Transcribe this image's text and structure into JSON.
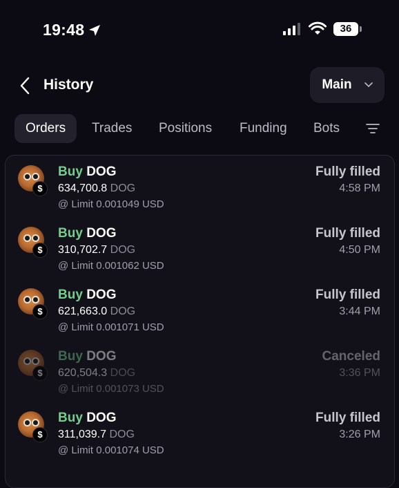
{
  "status_bar": {
    "time": "19:48",
    "battery": "36"
  },
  "header": {
    "title": "History",
    "account": "Main"
  },
  "tabs": [
    {
      "label": "Orders",
      "active": true
    },
    {
      "label": "Trades",
      "active": false
    },
    {
      "label": "Positions",
      "active": false
    },
    {
      "label": "Funding",
      "active": false
    },
    {
      "label": "Bots",
      "active": false
    }
  ],
  "orders": [
    {
      "side": "Buy",
      "asset": "DOG",
      "amount": "634,700.8",
      "unit": "DOG",
      "price_line": "@ Limit 0.001049 USD",
      "status": "Fully filled",
      "time": "4:58 PM",
      "coin_symbol": "$"
    },
    {
      "side": "Buy",
      "asset": "DOG",
      "amount": "310,702.7",
      "unit": "DOG",
      "price_line": "@ Limit 0.001062 USD",
      "status": "Fully filled",
      "time": "4:50 PM",
      "coin_symbol": "$"
    },
    {
      "side": "Buy",
      "asset": "DOG",
      "amount": "621,663.0",
      "unit": "DOG",
      "price_line": "@ Limit 0.001071 USD",
      "status": "Fully filled",
      "time": "3:44 PM",
      "coin_symbol": "$"
    },
    {
      "side": "Buy",
      "asset": "DOG",
      "amount": "620,504.3",
      "unit": "DOG",
      "price_line": "@ Limit 0.001073 USD",
      "status": "Canceled",
      "time": "3:36 PM",
      "coin_symbol": "$"
    },
    {
      "side": "Buy",
      "asset": "DOG",
      "amount": "311,039.7",
      "unit": "DOG",
      "price_line": "@ Limit 0.001074 USD",
      "status": "Fully filled",
      "time": "3:26 PM",
      "coin_symbol": "$"
    }
  ],
  "colors": {
    "buy": "#6fd18a",
    "background": "#0c0b13",
    "card": "#12111a"
  }
}
